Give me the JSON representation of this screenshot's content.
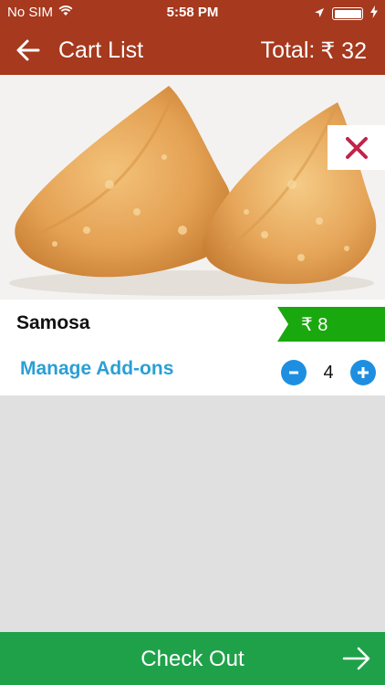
{
  "status_bar": {
    "carrier": "No SIM",
    "time": "5:58 PM"
  },
  "header": {
    "title": "Cart List",
    "total_label": "Total:",
    "total_value": "₹ 32"
  },
  "cart_item": {
    "name": "Samosa",
    "price": "₹ 8",
    "manage_addons_label": "Manage Add-ons",
    "quantity": "4"
  },
  "checkout": {
    "label": "Check Out"
  },
  "colors": {
    "header_bg": "#a6391e",
    "price_tag": "#1aa80f",
    "accent_blue": "#2a9fd6",
    "checkout_bg": "#1fa14a",
    "remove_icon": "#c0244a"
  }
}
